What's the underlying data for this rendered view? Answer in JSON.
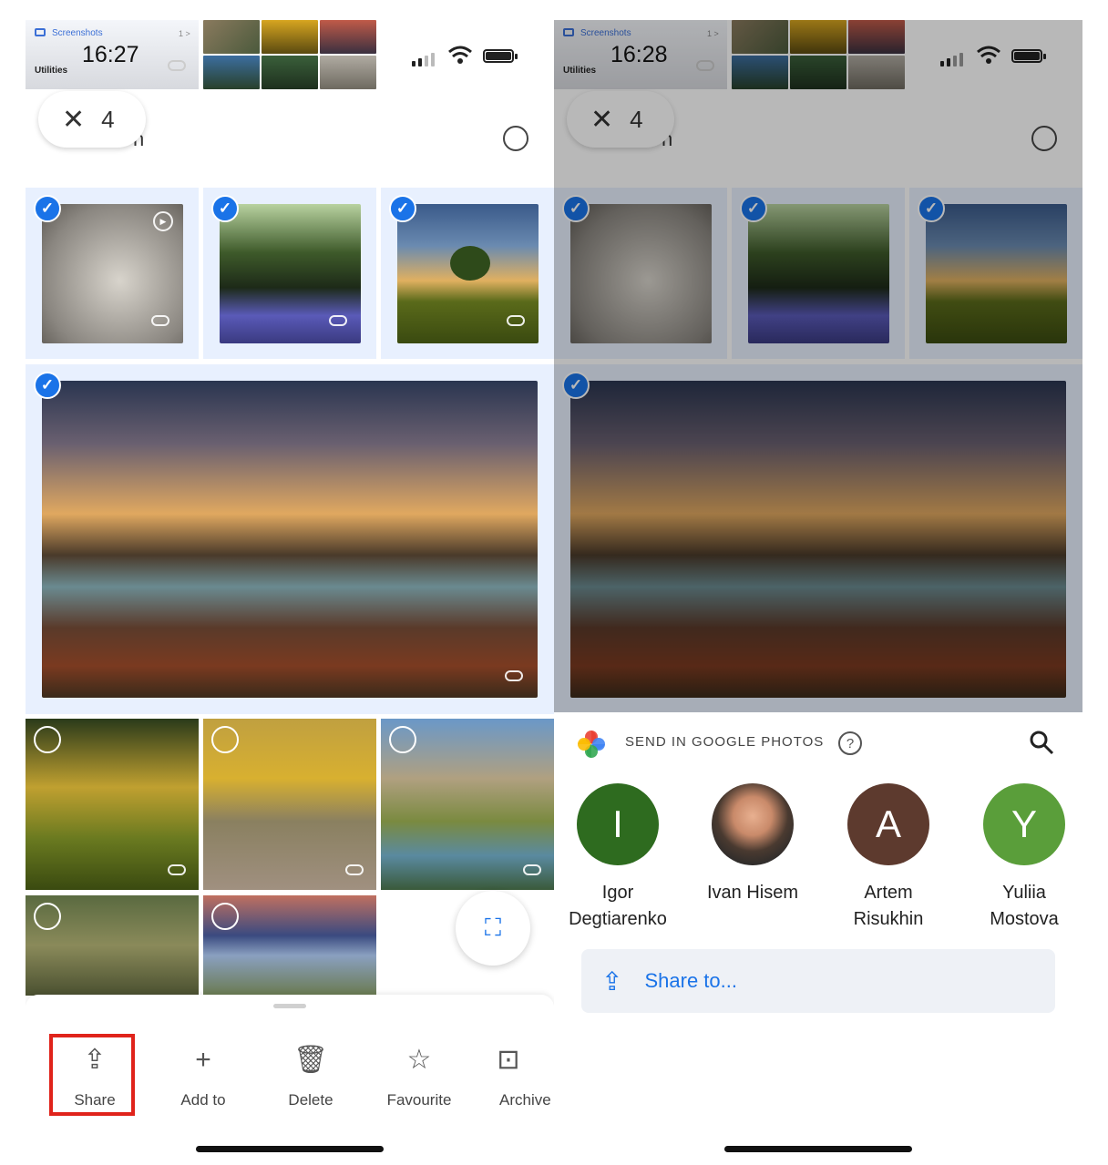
{
  "left": {
    "status_bar": {
      "screenshot_card": {
        "app_label": "Screenshots",
        "time": "16:27",
        "subtitle": "Utilities",
        "page_indicator": "1 >"
      }
    },
    "selection": {
      "close_icon": "close-icon",
      "count": "4",
      "partial_title": "n"
    },
    "actions": [
      {
        "label": "Share",
        "icon": "share-icon",
        "highlighted": true
      },
      {
        "label": "Add to",
        "icon": "plus-icon"
      },
      {
        "label": "Delete",
        "icon": "trash-icon"
      },
      {
        "label": "Favourite",
        "icon": "star-icon"
      },
      {
        "label": "Archive",
        "icon": "archive-icon"
      }
    ],
    "selected_photos": 4,
    "highlight_color": "#e0231b"
  },
  "right": {
    "status_bar": {
      "screenshot_card": {
        "app_label": "Screenshots",
        "time": "16:28",
        "subtitle": "Utilities",
        "page_indicator": "1 >"
      }
    },
    "selection": {
      "count": "4",
      "partial_title": "n"
    },
    "share_sheet": {
      "title": "SEND IN GOOGLE PHOTOS",
      "help_icon": "?",
      "contacts": [
        {
          "initial": "I",
          "name_line1": "Igor",
          "name_line2": "Degtiarenko",
          "color": "#2e6b1f"
        },
        {
          "initial": "",
          "name_line1": "Ivan Hisem",
          "name_line2": "",
          "color": "#6b5a4a"
        },
        {
          "initial": "A",
          "name_line1": "Artem",
          "name_line2": "Risukhin",
          "color": "#5d3a2e"
        },
        {
          "initial": "Y",
          "name_line1": "Yuliia",
          "name_line2": "Mostova",
          "color": "#5a9e3a"
        }
      ],
      "share_to_label": "Share to..."
    }
  },
  "colors": {
    "accent": "#1a73e8",
    "selection_bg": "#e8f0fe"
  }
}
